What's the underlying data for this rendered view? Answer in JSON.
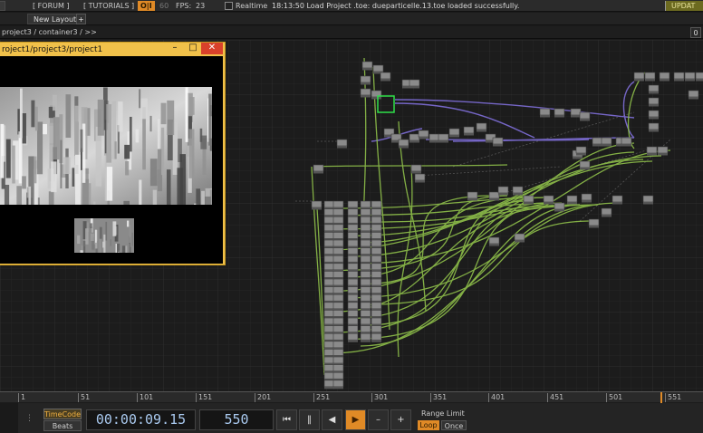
{
  "topbar": {
    "forum": "[ FORUM ]",
    "tutorials": "[ TUTORIALS ]",
    "perf_badge": "O|I",
    "perf_dim": "60",
    "fps_label": "FPS:",
    "fps_value": "23",
    "realtime": "Realtime",
    "status": "18:13:50 Load Project .toe: dueparticelle.13.toe loaded successfully.",
    "update": "UPDAT"
  },
  "layoutbar": {
    "tab_label": "New Layout",
    "add_label": "+"
  },
  "pathbar": {
    "path": "project3 / container3 / >>",
    "zero": "0"
  },
  "viewer": {
    "title": "roject1/project3/project1",
    "min": "–",
    "max": "□",
    "close": "✕"
  },
  "timeline": {
    "ticks": [
      "1",
      "51",
      "101",
      "151",
      "201",
      "251",
      "301",
      "351",
      "401",
      "451",
      "501",
      "551"
    ]
  },
  "controls": {
    "timecode": "TimeCode",
    "beats": "Beats",
    "time": "00:00:09.15",
    "frame": "550",
    "rewind": "⏮",
    "pause": "‖",
    "back": "◀",
    "play": "▶",
    "minus": "–",
    "plus": "+",
    "range_limit": "Range Limit",
    "loop": "Loop",
    "once": "Once"
  },
  "colors": {
    "accent_orange": "#e08a26",
    "wire_green": "#8fc04a",
    "wire_purple": "#7a6ad0",
    "viewer_frame": "#f1c14a"
  }
}
